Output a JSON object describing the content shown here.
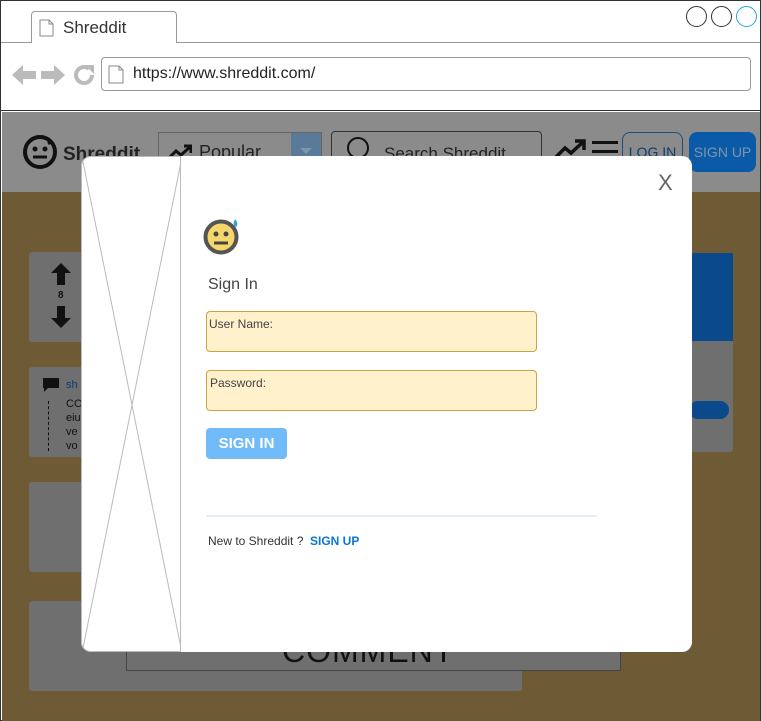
{
  "browser": {
    "tab_title": "Shreddit",
    "url": "https://www.shreddit.com/"
  },
  "header": {
    "logo_text": "Shreddit",
    "feed_select": "Popular",
    "search_placeholder": "Search Shreddit",
    "login_label": "LOG IN",
    "signup_label": "SIGN UP"
  },
  "post": {
    "vote_count": "8",
    "partial_link": "sh",
    "partial_lines": [
      "CO",
      "eiu",
      "ve",
      "vo"
    ]
  },
  "comment_label": "COMMENT",
  "modal": {
    "close_label": "X",
    "heading": "Sign In",
    "username_label": "User Name:",
    "password_label": "Password:",
    "signin_button": "SIGN IN",
    "new_prompt": "New to Shreddit ?",
    "signup_link": "SIGN UP"
  },
  "colors": {
    "overlay_header": "#8b8b8b",
    "overlay_body": "#6e5b35",
    "field_bg": "#fef1cc",
    "signin_button": "#71bcf8",
    "link_blue": "#0a75d8"
  }
}
